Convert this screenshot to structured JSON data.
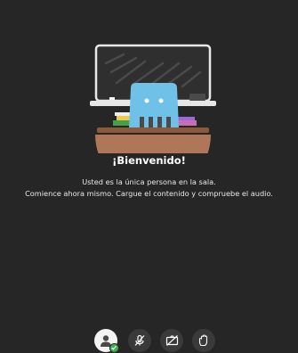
{
  "welcome": {
    "title": "¡Bienvenido!",
    "line1": "Usted es la única persona en la sala.",
    "line2": "Comience ahora mismo. Cargue el contenido y compruebe el audio."
  },
  "controls": [
    {
      "icon": "user-icon",
      "status": "connected"
    },
    {
      "icon": "mic-muted-icon"
    },
    {
      "icon": "camera-off-icon"
    },
    {
      "icon": "raise-hand-icon"
    }
  ],
  "colors": {
    "background": "#262626",
    "button": "#3a3a3a",
    "status_green": "#37b24d",
    "chalkboard": "#2e2e2e",
    "chalk_tray": "#e6e6e6",
    "character_blue": "#6fc1e7",
    "table_brown": "#8a5a3a"
  }
}
